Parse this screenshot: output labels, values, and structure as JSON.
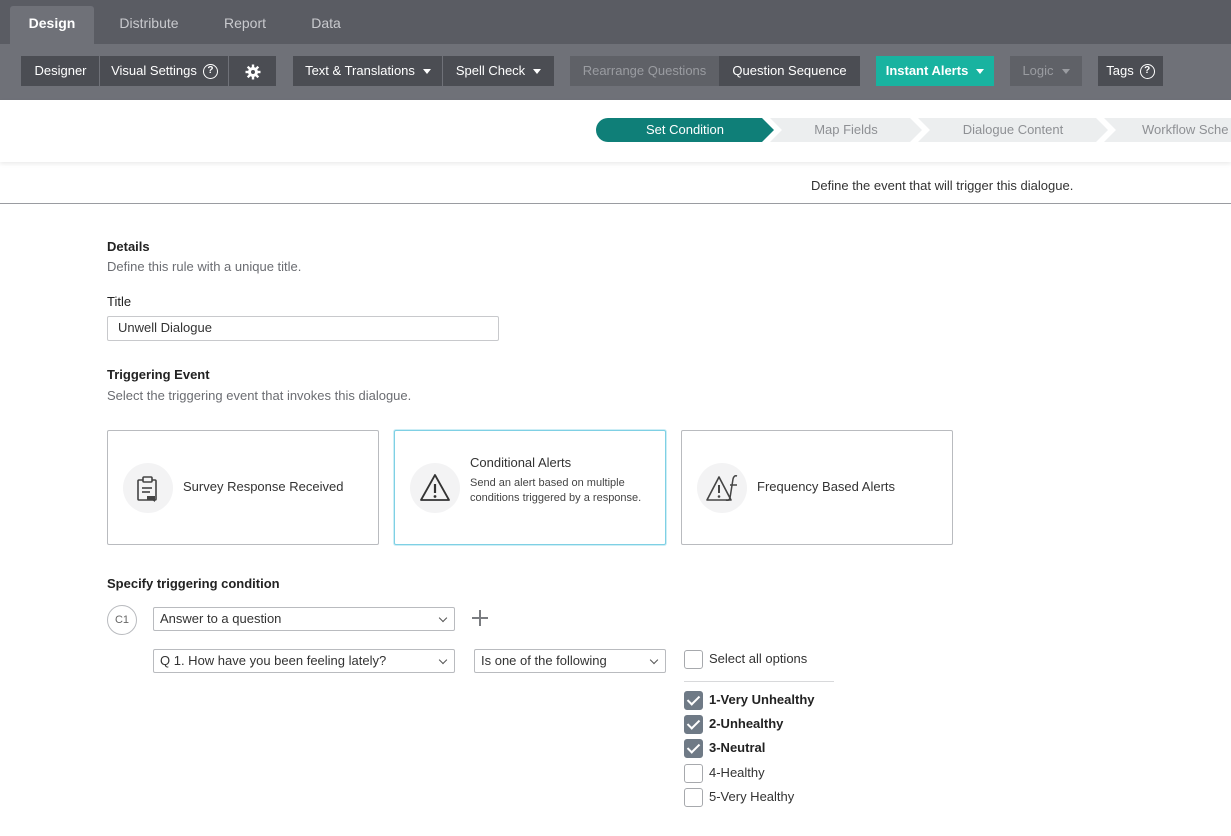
{
  "topnav": {
    "tabs": [
      {
        "label": "Design",
        "active": true
      },
      {
        "label": "Distribute",
        "active": false
      },
      {
        "label": "Report",
        "active": false
      },
      {
        "label": "Data",
        "active": false
      }
    ]
  },
  "toolbar": {
    "designer": "Designer",
    "visual_settings": "Visual Settings",
    "text_translations": "Text & Translations",
    "spell_check": "Spell Check",
    "rearrange_questions": "Rearrange Questions",
    "question_sequence": "Question Sequence",
    "instant_alerts": "Instant Alerts",
    "logic": "Logic",
    "tags": "Tags",
    "accent_color": "#18b3a0"
  },
  "steps": [
    {
      "label": "Set Condition",
      "active": true
    },
    {
      "label": "Map Fields",
      "active": false
    },
    {
      "label": "Dialogue Content",
      "active": false
    },
    {
      "label": "Workflow Sche",
      "active": false
    }
  ],
  "steps_active_color": "#0f7f78",
  "page_subtitle": "Define the event that will trigger this dialogue.",
  "details": {
    "heading": "Details",
    "description": "Define this rule with a unique title.",
    "title_label": "Title",
    "title_value": "Unwell Dialogue"
  },
  "triggering_event": {
    "heading": "Triggering Event",
    "description": "Select the triggering event that invokes this dialogue.",
    "cards": [
      {
        "title": "Survey Response Received",
        "description": "",
        "icon": "clipboard-icon",
        "selected": false
      },
      {
        "title": "Conditional Alerts",
        "description": "Send an alert based on multiple conditions triggered by a response.",
        "icon": "warning-icon",
        "selected": true
      },
      {
        "title": "Frequency Based Alerts",
        "description": "",
        "icon": "frequency-alert-icon",
        "selected": false
      }
    ]
  },
  "condition": {
    "heading": "Specify triggering condition",
    "id": "C1",
    "type_value": "Answer to a question",
    "question_value": "Q 1. How have you been feeling lately?",
    "operator_value": "Is one of the following",
    "select_all_label": "Select all options",
    "options": [
      {
        "label": "1-Very Unhealthy",
        "checked": true
      },
      {
        "label": "2-Unhealthy",
        "checked": true
      },
      {
        "label": "3-Neutral",
        "checked": true
      },
      {
        "label": "4-Healthy",
        "checked": false
      },
      {
        "label": "5-Very Healthy",
        "checked": false
      }
    ]
  }
}
